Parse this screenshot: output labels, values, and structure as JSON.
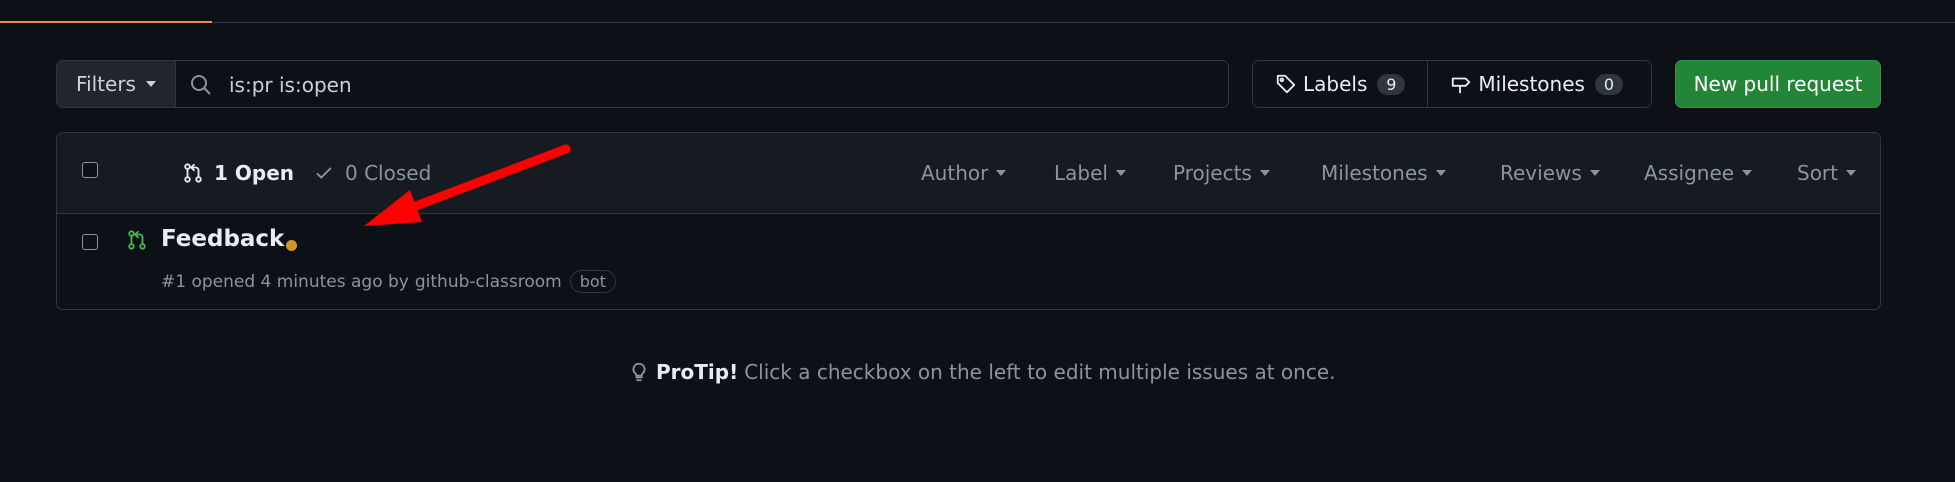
{
  "top_nav": {},
  "toolbar": {
    "filters_label": "Filters",
    "search_value": "is:pr is:open",
    "labels_label": "Labels",
    "labels_count": "9",
    "milestones_label": "Milestones",
    "milestones_count": "0",
    "new_pr_label": "New pull request"
  },
  "list_header": {
    "open_label": "1 Open",
    "closed_label": "0 Closed",
    "filters": [
      "Author",
      "Label",
      "Projects",
      "Milestones",
      "Reviews",
      "Assignee",
      "Sort"
    ]
  },
  "pull_requests": [
    {
      "title": "Feedback",
      "meta_prefix": "#1 opened 4 minutes ago by",
      "author": "github-classroom",
      "label": "bot",
      "status_color": "#d29922"
    }
  ],
  "protip": {
    "title": "ProTip!",
    "text": "Click a checkbox on the left to edit multiple issues at once."
  },
  "colors": {
    "background": "#0d1117",
    "accent_green": "#238636",
    "open_icon": "#3fb950",
    "annotation_arrow": "#ff0000"
  }
}
